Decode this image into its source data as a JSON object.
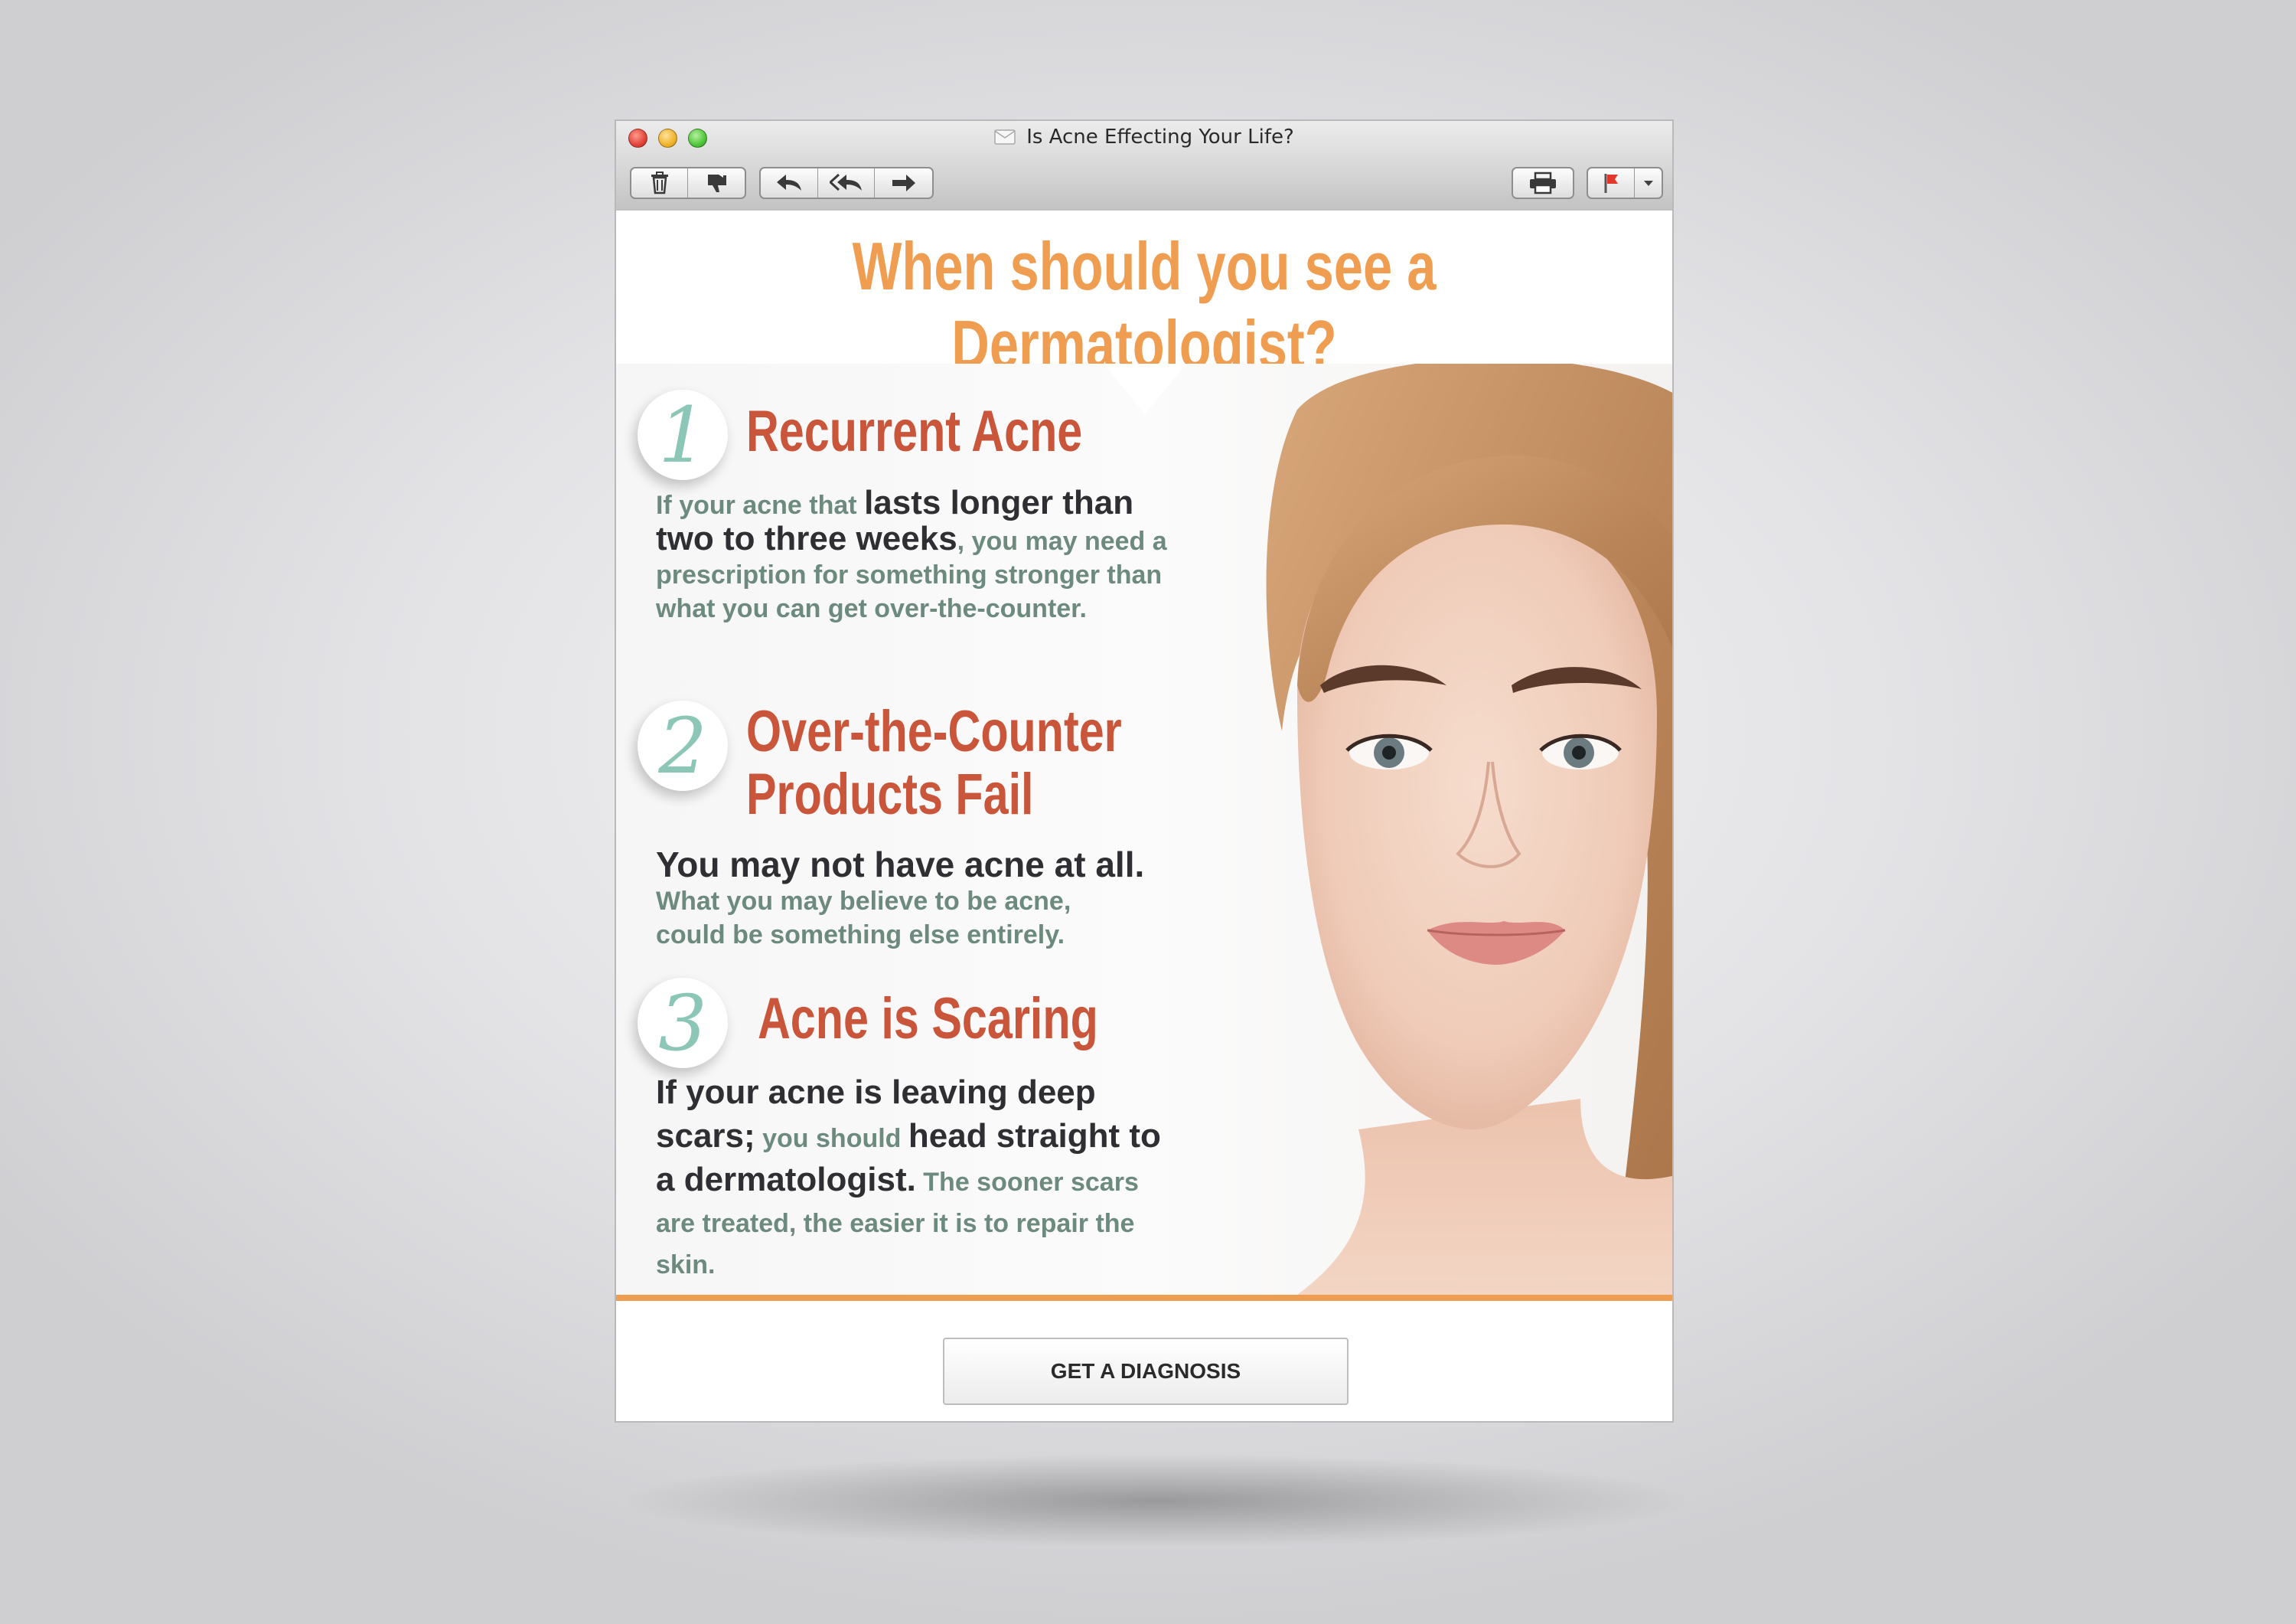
{
  "window": {
    "title": "Is Acne Effecting Your Life?"
  },
  "toolbar": {
    "icons": [
      "trash-icon",
      "thumbs-down-icon",
      "reply-icon",
      "reply-all-icon",
      "forward-icon",
      "print-icon",
      "flag-icon",
      "chevron-down-icon"
    ]
  },
  "email": {
    "headline": "When should you see a Dermatologist?",
    "sections": [
      {
        "number": "1",
        "title": "Recurrent Acne",
        "body": [
          {
            "text": "If your acne that ",
            "emphasis": false
          },
          {
            "text": "lasts longer than two to three weeks",
            "emphasis": true
          },
          {
            "text": ", you may need a prescription for something stronger than what you can get over-the-counter.",
            "emphasis": false
          }
        ]
      },
      {
        "number": "2",
        "title_line1": "Over-the-Counter",
        "title_line2": "Products Fail",
        "body": [
          {
            "text": "You may not have acne at all.",
            "emphasis": true
          },
          {
            "text": "What you may believe to be acne, could be something else entirely.",
            "emphasis": false
          }
        ]
      },
      {
        "number": "3",
        "title": "Acne is Scaring",
        "body": [
          {
            "text": "If your acne is leaving deep scars;",
            "emphasis": true
          },
          {
            "text": " you should ",
            "emphasis": false
          },
          {
            "text": "head straight to a dermatologist.",
            "emphasis": true
          },
          {
            "text": " The sooner scars are treated, the easier it is to repair the skin.",
            "emphasis": false
          }
        ]
      }
    ],
    "cta_label": "GET A DIAGNOSIS",
    "colors": {
      "headline": "#ef9d51",
      "section_title": "#c9553a",
      "number": "#8cc6b6",
      "body": "#6d8a7e",
      "body_emphasis": "#2f2f33",
      "rule": "#ef9d51"
    }
  }
}
